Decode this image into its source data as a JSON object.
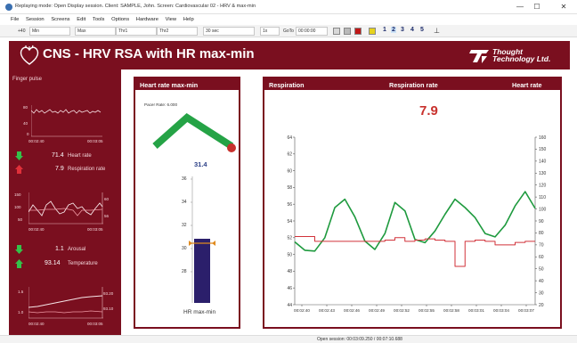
{
  "window": {
    "title": "Replaying mode: Open Display session. Client: SAMPLE, John. Screen: Cardiovascular 02 - HRV & max-min",
    "minimize": "—",
    "maximize": "☐",
    "close": "✕"
  },
  "menu": [
    "File",
    "Session",
    "Screens",
    "Edit",
    "Tools",
    "Options",
    "Hardware",
    "View",
    "Help"
  ],
  "toolbar": {
    "sel1": "Min",
    "sel1_prefix": "+40",
    "sel2": "Max",
    "sel3": "Thr1",
    "sel4": "Thr2",
    "sel5": "30 sec",
    "speed": "1x",
    "goto_label": "GoTo",
    "goto_value": "00:00:00",
    "screens": [
      "1",
      "2",
      "3",
      "4",
      "5"
    ]
  },
  "banner": {
    "title": "CNS - HRV RSA with HR max-min",
    "logo_line1": "Thought",
    "logo_line2": "Technology Ltd."
  },
  "left": {
    "finger_pulse_label": "Finger pulse",
    "fp_ticks": [
      "80",
      "40",
      "0"
    ],
    "fp_times": [
      "00:02:40",
      "00:03:05"
    ],
    "heart_rate_value": "71.4",
    "heart_rate_label": "Heart rate",
    "resp_rate_value": "7.9",
    "resp_rate_label": "Respiration rate",
    "mid_left_ticks": [
      "150",
      "100",
      "50"
    ],
    "mid_right_ticks": [
      "60",
      "56"
    ],
    "mid_times": [
      "00:02:40",
      "00:03:05"
    ],
    "arousal_value": "1.1",
    "arousal_label": "Arousal",
    "temp_value": "93.14",
    "temp_label": "Temperature",
    "bot_left_ticks": [
      "1.5",
      "1.0"
    ],
    "bot_right_ticks": [
      "93.20",
      "93.10"
    ],
    "bot_times": [
      "00:02:40",
      "00:03:05"
    ]
  },
  "hr_panel": {
    "header": "Heart rate max-min",
    "pacer_label": "Pacer Rate: 6.000",
    "value": "31.4",
    "footer": "HR max-min",
    "bar_ticks": [
      "36",
      "34",
      "32",
      "30",
      "28"
    ]
  },
  "resp_panel": {
    "header_left": "Respiration",
    "header_center": "Respiration rate",
    "header_right": "Heart rate",
    "value": "7.9"
  },
  "status": {
    "text": "Open session: 00:03:09.250 / 00:07:10.688"
  },
  "colors": {
    "brand": "#7a0f1f",
    "resp_line": "#1e9a3e",
    "hr_line": "#d1323a",
    "hr_bar": "#2b1f6b"
  },
  "chart_data": {
    "type": "line",
    "x": [
      "00:02:40",
      "00:02:43",
      "00:02:46",
      "00:02:49",
      "00:02:52",
      "00:02:55",
      "00:02:58",
      "00:03:01",
      "00:03:04",
      "00:03:07"
    ],
    "y_left_ticks": [
      "64",
      "62",
      "60",
      "58",
      "56",
      "54",
      "52",
      "50",
      "48",
      "46",
      "44"
    ],
    "y_right_ticks": [
      "160",
      "150",
      "140",
      "130",
      "120",
      "110",
      "100",
      "90",
      "80",
      "70",
      "60",
      "50",
      "40",
      "30",
      "20"
    ],
    "ylim_left": [
      44,
      64
    ],
    "ylim_right": [
      20,
      160
    ],
    "series": [
      {
        "axis": "left",
        "color": "#1e9a3e",
        "values": [
          51.5,
          50.5,
          50.4,
          52,
          55.6,
          56.6,
          54.5,
          51.6,
          50.6,
          52.5,
          56.2,
          55.2,
          51.8,
          51.4,
          52.8,
          54.8,
          56.6,
          55.6,
          54.4,
          52.5,
          52.1,
          53.5,
          55.8,
          57.5,
          55.5
        ]
      },
      {
        "axis": "right",
        "color": "#d1323a",
        "values": [
          77,
          77,
          73,
          73,
          73,
          73,
          73,
          73,
          73,
          74,
          76,
          73,
          74,
          75,
          74,
          73,
          52,
          73,
          74,
          73,
          70,
          70,
          72,
          73,
          73
        ]
      }
    ]
  }
}
